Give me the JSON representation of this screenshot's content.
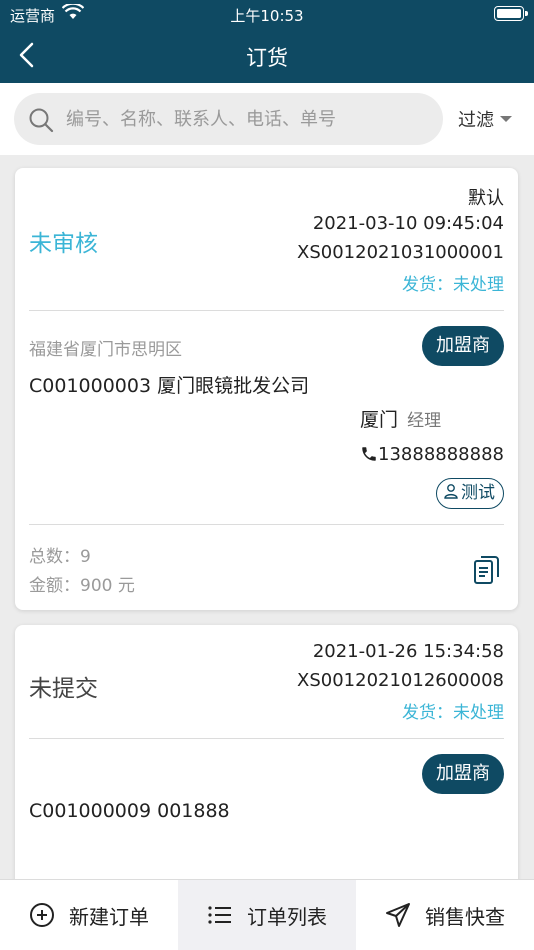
{
  "status_bar": {
    "carrier": "运营商",
    "time": "上午10:53"
  },
  "nav": {
    "title": "订货"
  },
  "search": {
    "placeholder": "编号、名称、联系人、电话、单号",
    "filter_label": "过滤"
  },
  "orders": [
    {
      "default_label": "默认",
      "status": "未审核",
      "datetime": "2021-03-10 09:45:04",
      "order_no": "XS0012021031000001",
      "shipping": "发货：未处理",
      "address": "福建省厦门市思明区",
      "customer_type": "加盟商",
      "customer": "C001000003 厦门眼镜批发公司",
      "contact_name": "厦门",
      "contact_role": "经理",
      "phone": "13888888888",
      "salesperson": "测试",
      "total_count": "总数：9",
      "amount": "金额：900 元"
    },
    {
      "status": "未提交",
      "datetime": "2021-01-26 15:34:58",
      "order_no": "XS0012021012600008",
      "shipping": "发货：未处理",
      "customer_type": "加盟商",
      "customer": "C001000009 001888"
    }
  ],
  "tabbar": {
    "new_order": "新建订单",
    "order_list": "订单列表",
    "sales_query": "销售快查"
  },
  "colors": {
    "primary": "#0f4a63",
    "accent": "#3bb5d6"
  }
}
